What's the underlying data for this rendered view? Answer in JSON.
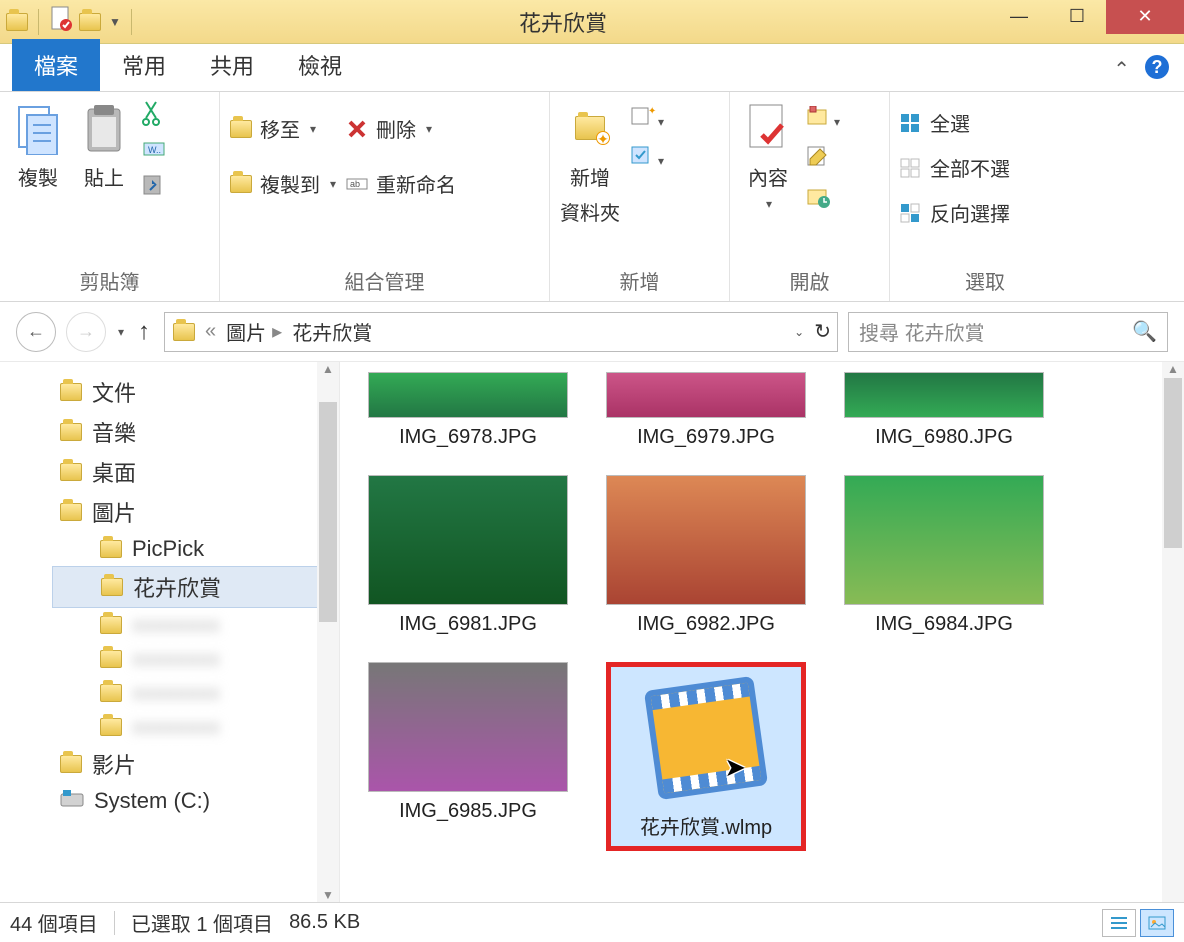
{
  "window": {
    "title": "花卉欣賞"
  },
  "tabs": {
    "file": "檔案",
    "home": "常用",
    "share": "共用",
    "view": "檢視"
  },
  "ribbon": {
    "clipboard": {
      "copy": "複製",
      "paste": "貼上",
      "label": "剪貼簿"
    },
    "organize": {
      "move_to": "移至",
      "copy_to": "複製到",
      "delete": "刪除",
      "rename": "重新命名",
      "label": "組合管理"
    },
    "new": {
      "new_folder_l1": "新增",
      "new_folder_l2": "資料夾",
      "label": "新增"
    },
    "open": {
      "properties": "內容",
      "label": "開啟"
    },
    "select": {
      "all": "全選",
      "none": "全部不選",
      "invert": "反向選擇",
      "label": "選取"
    }
  },
  "address": {
    "root": "圖片",
    "folder": "花卉欣賞",
    "search_placeholder": "搜尋 花卉欣賞"
  },
  "tree": {
    "items": [
      {
        "label": "文件",
        "type": "folder"
      },
      {
        "label": "音樂",
        "type": "folder"
      },
      {
        "label": "桌面",
        "type": "folder"
      },
      {
        "label": "圖片",
        "type": "folder"
      },
      {
        "label": "PicPick",
        "type": "folder",
        "indent": true
      },
      {
        "label": "花卉欣賞",
        "type": "folder",
        "indent": true,
        "selected": true
      },
      {
        "label": "xxxxxxxx",
        "type": "folder",
        "indent": true,
        "dim": true
      },
      {
        "label": "xxxxxxxx",
        "type": "folder",
        "indent": true,
        "dim": true
      },
      {
        "label": "xxxxxxxx",
        "type": "folder",
        "indent": true,
        "dim": true
      },
      {
        "label": "xxxxxxxx",
        "type": "folder",
        "indent": true,
        "dim": true
      },
      {
        "label": "影片",
        "type": "folder"
      },
      {
        "label": "System (C:)",
        "type": "drive"
      }
    ]
  },
  "files": {
    "row1": [
      {
        "name": "IMG_6978.JPG",
        "ph": "ph1"
      },
      {
        "name": "IMG_6979.JPG",
        "ph": "ph2"
      },
      {
        "name": "IMG_6980.JPG",
        "ph": "ph3"
      }
    ],
    "row2": [
      {
        "name": "IMG_6981.JPG",
        "ph": "ph4"
      },
      {
        "name": "IMG_6982.JPG",
        "ph": "ph5"
      },
      {
        "name": "IMG_6984.JPG",
        "ph": "ph6"
      }
    ],
    "row3": [
      {
        "name": "IMG_6985.JPG",
        "ph": "ph7"
      },
      {
        "name": "花卉欣賞.wlmp",
        "wlmp": true,
        "selected": true
      }
    ]
  },
  "status": {
    "count": "44 個項目",
    "selection": "已選取 1 個項目",
    "size": "86.5 KB"
  }
}
